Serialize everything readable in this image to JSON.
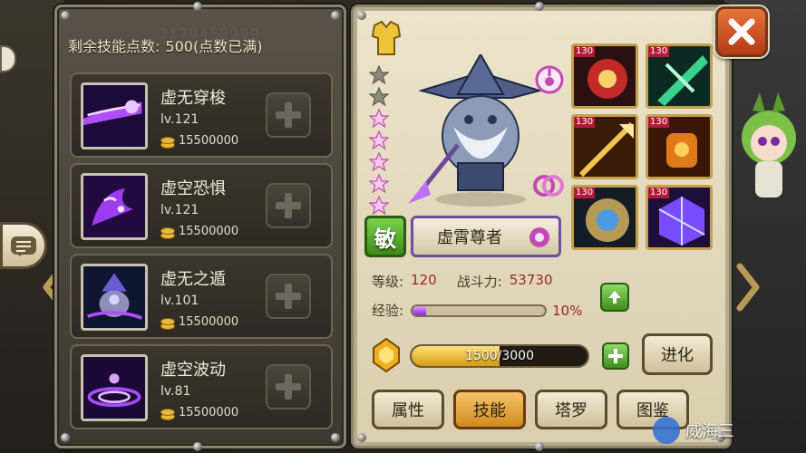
{
  "left_panel": {
    "skill_points_label": "剩余技能点数:",
    "skill_points_value": "500(点数已满)",
    "faded_text": "3179458999",
    "skills": [
      {
        "name": "虚无穿梭",
        "level": "lv.121",
        "cost": "15500000",
        "icon": "purple-comet-icon"
      },
      {
        "name": "虚空恐惧",
        "level": "lv.121",
        "cost": "15500000",
        "icon": "purple-spirit-icon"
      },
      {
        "name": "虚无之遁",
        "level": "lv.101",
        "cost": "15500000",
        "icon": "shadow-mage-icon"
      },
      {
        "name": "虚空波动",
        "level": "lv.81",
        "cost": "15500000",
        "icon": "purple-wave-icon"
      }
    ]
  },
  "hero": {
    "class_badge": "敏",
    "name": "虚霄尊者",
    "level_label": "等级:",
    "level_value": "120",
    "power_label": "战斗力:",
    "power_value": "53730",
    "exp_label": "经验:",
    "exp_percent": "10%",
    "exp_fraction": 0.1,
    "stars_total": 7,
    "stars_lit": 5,
    "gold_current": "1500/3000",
    "gold_fraction": 0.5,
    "equipment": [
      {
        "level": "130",
        "icon": "red-crest-icon"
      },
      {
        "level": "130",
        "icon": "green-blade-icon"
      },
      {
        "level": "130",
        "icon": "golden-spear-icon"
      },
      {
        "level": "130",
        "icon": "fire-gauntlet-icon"
      },
      {
        "level": "130",
        "icon": "gear-orb-icon"
      },
      {
        "level": "130",
        "icon": "purple-cube-icon"
      }
    ]
  },
  "buttons": {
    "evolve": "进化",
    "close": "关闭"
  },
  "tabs": [
    "属性",
    "技能",
    "塔罗",
    "图鉴"
  ],
  "active_tab": "技能",
  "watermark": "威海三",
  "colors": {
    "accent_red": "#a2232a",
    "exp_purple": "#8c28d6",
    "gold": "#d79b12"
  }
}
